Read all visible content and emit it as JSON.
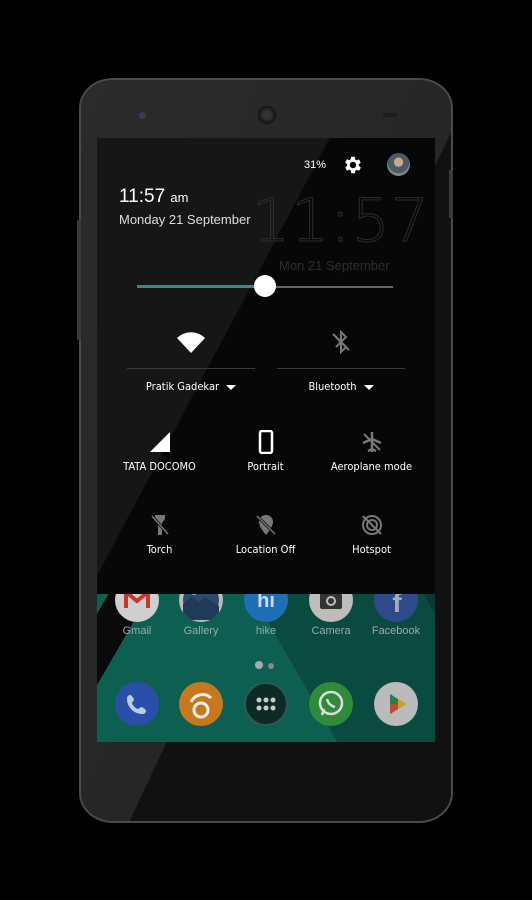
{
  "status": {
    "battery_percent": "31%",
    "time": "11:57",
    "ampm": "am",
    "date_long": "Monday 21 September",
    "lock_clock": "11:57",
    "lock_date": "Mon 21 September"
  },
  "brightness": {
    "level": 0.5,
    "accent_color": "#2f8f86"
  },
  "quick_settings": {
    "wifi": {
      "label": "Pratik Gadekar",
      "icon": "wifi-icon",
      "active": true
    },
    "bluetooth": {
      "label": "Bluetooth",
      "icon": "bluetooth-off-icon",
      "active": false
    },
    "tiles": [
      {
        "label": "TATA DOCOMO",
        "icon": "cell-signal-icon",
        "active": true
      },
      {
        "label": "Portrait",
        "icon": "portrait-rotation-icon",
        "active": true
      },
      {
        "label": "Aeroplane mode",
        "icon": "airplane-icon",
        "active": false
      },
      {
        "label": "Torch",
        "icon": "torch-off-icon",
        "active": false
      },
      {
        "label": "Location Off",
        "icon": "location-off-icon",
        "active": false
      },
      {
        "label": "Hotspot",
        "icon": "hotspot-off-icon",
        "active": false
      }
    ]
  },
  "home": {
    "apps": [
      {
        "label": "Gmail",
        "icon": "gmail-icon"
      },
      {
        "label": "Gallery",
        "icon": "gallery-icon"
      },
      {
        "label": "hike",
        "icon": "hike-icon"
      },
      {
        "label": "Camera",
        "icon": "camera-icon"
      },
      {
        "label": "Facebook",
        "icon": "facebook-icon"
      }
    ],
    "dock": [
      {
        "icon": "phone-icon"
      },
      {
        "icon": "uc-browser-icon"
      },
      {
        "icon": "app-drawer-icon"
      },
      {
        "icon": "whatsapp-icon"
      },
      {
        "icon": "play-store-icon"
      }
    ],
    "pages": 2,
    "current_page": 1
  }
}
